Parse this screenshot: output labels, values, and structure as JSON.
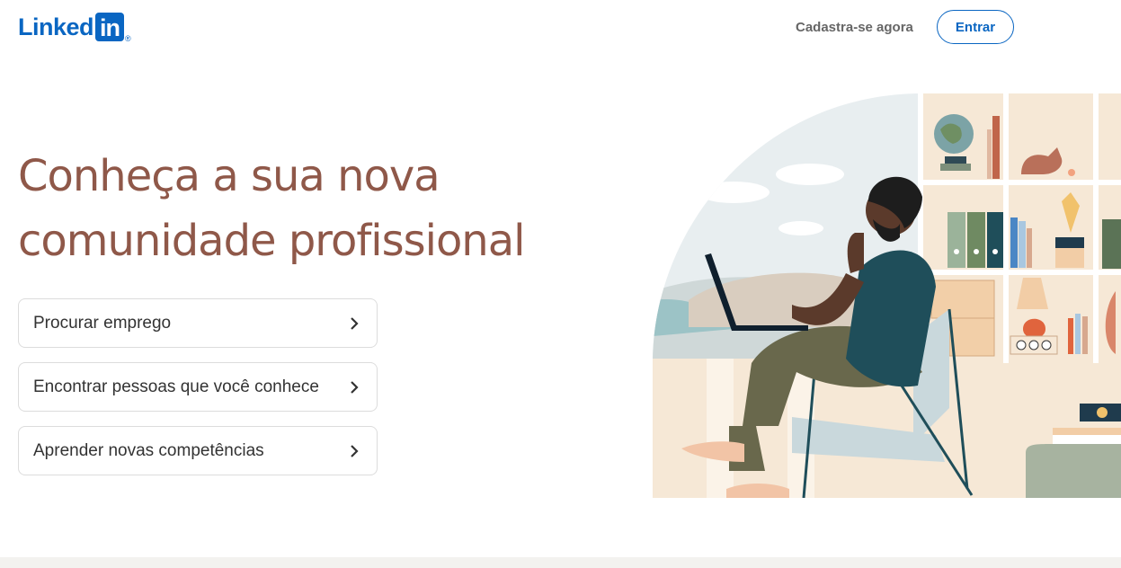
{
  "header": {
    "logo_text": "Linked",
    "logo_box": "in",
    "logo_mark": "®",
    "signup_label": "Cadastra-se agora",
    "signin_label": "Entrar"
  },
  "hero": {
    "headline_line1": "Conheça a sua nova",
    "headline_line2": "comunidade profissional"
  },
  "options": [
    {
      "label": "Procurar emprego",
      "icon": "chevron-right-icon"
    },
    {
      "label": "Encontrar pessoas que você conhece",
      "icon": "chevron-right-icon"
    },
    {
      "label": "Aprender novas competências",
      "icon": "chevron-right-icon"
    }
  ],
  "colors": {
    "brand": "#0a66c2",
    "headline": "#8f5849",
    "text": "#333333",
    "muted": "#666666"
  }
}
